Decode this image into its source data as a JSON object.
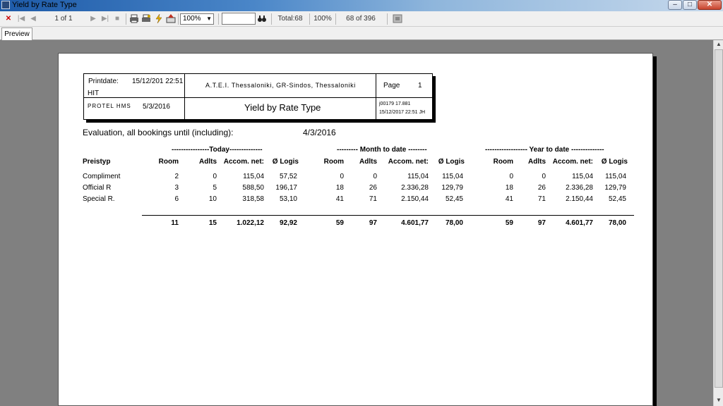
{
  "window": {
    "title": "Yield by Rate Type",
    "min": "‒",
    "max": "□",
    "close": "✕"
  },
  "toolbar": {
    "page_indicator": "1 of 1",
    "zoom": "100%",
    "total": "Total:68",
    "percent": "100%",
    "progress": "68 of 396",
    "search_value": ""
  },
  "tabs": [
    "Preview"
  ],
  "report": {
    "header": {
      "printdate_label": "Printdate:",
      "printdate_value": "15/12/201 22:51",
      "hit": "HIT",
      "system": "PROTEL HMS",
      "system_date": "5/3/2016",
      "hotel": "A.T.E.I. Thessaloniki, GR-Sindos, Thessaloniki",
      "title": "Yield by Rate Type",
      "page_label": "Page",
      "page_no": "1",
      "code": "j00179 17.881",
      "stamp": "15/12/2017 22:51  JH"
    },
    "evaluation_label": "Evaluation, all bookings until (including):",
    "evaluation_date": "4/3/2016",
    "groups": {
      "today": "----------------Today--------------",
      "month": "--------- Month to date --------",
      "year": "------------------ Year to date --------------"
    },
    "columns": {
      "preistyp": "Preistyp",
      "room": "Room",
      "adults": "Adlts",
      "accom": "Accom. net:",
      "logis": "Ø Logis"
    },
    "rows": [
      {
        "name": "Compliment",
        "t": [
          "2",
          "0",
          "115,04",
          "57,52"
        ],
        "m": [
          "0",
          "0",
          "115,04",
          "115,04"
        ],
        "y": [
          "0",
          "0",
          "115,04",
          "115,04"
        ]
      },
      {
        "name": "Official R",
        "t": [
          "3",
          "5",
          "588,50",
          "196,17"
        ],
        "m": [
          "18",
          "26",
          "2.336,28",
          "129,79"
        ],
        "y": [
          "18",
          "26",
          "2.336,28",
          "129,79"
        ]
      },
      {
        "name": "Special R.",
        "t": [
          "6",
          "10",
          "318,58",
          "53,10"
        ],
        "m": [
          "41",
          "71",
          "2.150,44",
          "52,45"
        ],
        "y": [
          "41",
          "71",
          "2.150,44",
          "52,45"
        ]
      }
    ],
    "totals": {
      "t": [
        "11",
        "15",
        "1.022,12",
        "92,92"
      ],
      "m": [
        "59",
        "97",
        "4.601,77",
        "78,00"
      ],
      "y": [
        "59",
        "97",
        "4.601,77",
        "78,00"
      ]
    }
  }
}
